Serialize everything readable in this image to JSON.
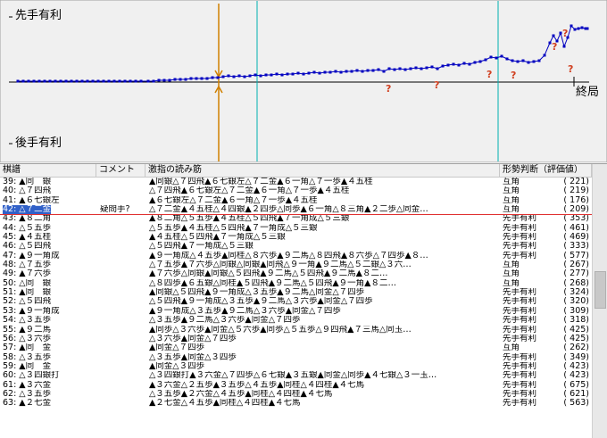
{
  "graph": {
    "label_top": "先手有利",
    "label_bottom": "後手有利",
    "label_end": "終局",
    "accent": "#0000c0",
    "cursor_color": "#d08000",
    "question_color": "#d04020"
  },
  "columns": [
    "棋譜",
    "コメント",
    "激指の読み筋",
    "形勢判断（評価値）"
  ],
  "rows": [
    {
      "move": "39: ▲同　銀",
      "comment": "",
      "pv": "▲同銀△７四飛▲６七銀左△７二金▲６一角△７一歩▲４五桂",
      "judge": "互角",
      "value": "(  221)"
    },
    {
      "move": "40: △７四飛",
      "comment": "",
      "pv": "△７四飛▲６七銀左△７二金▲６一角△７一歩▲４五桂",
      "judge": "互角",
      "value": "(  219)"
    },
    {
      "move": "41: ▲６七銀左",
      "comment": "",
      "pv": "▲６七銀左△７二金▲６一角△７一歩▲４五桂",
      "judge": "互角",
      "value": "(  176)"
    },
    {
      "move": "42: △７二金",
      "comment": "疑問手?",
      "pv": "△７二金▲４五桂△４四銀▲２四歩△同歩▲６一角△８三角▲２二歩△同金…",
      "judge": "互角",
      "value": "(  209)",
      "selected": true
    },
    {
      "move": "43: ▲８二角",
      "comment": "",
      "pv": "▲８二角△５五歩▲４五桂△５四飛▲７一角成△５三銀",
      "judge": "先手有利",
      "value": "(  353)"
    },
    {
      "move": "44: △５五歩",
      "comment": "",
      "pv": "△５五歩▲４五桂△５四飛▲７一角成△５三銀",
      "judge": "先手有利",
      "value": "(  461)"
    },
    {
      "move": "45: ▲４五桂",
      "comment": "",
      "pv": "▲４五桂△５四飛▲７一角成△５三銀",
      "judge": "先手有利",
      "value": "(  469)"
    },
    {
      "move": "46: △５四飛",
      "comment": "",
      "pv": "△５四飛▲７一角成△５三銀",
      "judge": "先手有利",
      "value": "(  333)"
    },
    {
      "move": "47: ▲９一角成",
      "comment": "",
      "pv": "▲９一角成△４五歩▲同桂△８六歩▲９二馬△８四飛▲８六歩△７四歩▲８…",
      "judge": "先手有利",
      "value": "(  577)"
    },
    {
      "move": "48: △７五歩",
      "comment": "",
      "pv": "△７五歩▲７六歩△同銀△同銀▲同飛△９一角▲９二馬△５二銀△３六…",
      "judge": "互角",
      "value": "(  267)"
    },
    {
      "move": "49: ▲７六歩",
      "comment": "",
      "pv": "▲７六歩△同銀▲同銀△５四飛▲９二馬△５四飛▲９二馬▲８二…",
      "judge": "互角",
      "value": "(  277)"
    },
    {
      "move": "50: △同　銀",
      "comment": "",
      "pv": "△８四歩▲６五銀△同桂▲５四飛▲９二馬△５四飛▲９一角▲８二…",
      "judge": "互角",
      "value": "(  268)"
    },
    {
      "move": "51: ▲同　銀",
      "comment": "",
      "pv": "▲同銀△５四飛▲９一角成△３五歩▲９二馬△同金△７四歩",
      "judge": "先手有利",
      "value": "(  324)"
    },
    {
      "move": "52: △５四飛",
      "comment": "",
      "pv": "△５四飛▲９一角成△３五歩▲９二馬△３六歩▲同金△７四歩",
      "judge": "先手有利",
      "value": "(  320)"
    },
    {
      "move": "53: ▲９一角成",
      "comment": "",
      "pv": "▲９一角成△３五歩▲９二馬△３六歩▲同金△７四歩",
      "judge": "先手有利",
      "value": "(  309)"
    },
    {
      "move": "54: △３五歩",
      "comment": "",
      "pv": "△３五歩▲９二馬△３六歩▲同金△７四歩",
      "judge": "先手有利",
      "value": "(  318)"
    },
    {
      "move": "55: ▲９二馬",
      "comment": "",
      "pv": "▲同歩△３六歩▲同金△５六歩▲同歩△５五歩△９四飛▲７三馬△同玉…",
      "judge": "先手有利",
      "value": "(  425)"
    },
    {
      "move": "56: △３六歩",
      "comment": "",
      "pv": "△３六歩▲同金△７四歩",
      "judge": "先手有利",
      "value": "(  425)"
    },
    {
      "move": "57: ▲同　金",
      "comment": "",
      "pv": "▲同金△７四歩",
      "judge": "互角",
      "value": "(  262)"
    },
    {
      "move": "58: △３五歩",
      "comment": "",
      "pv": "△３五歩▲同金△３四歩",
      "judge": "先手有利",
      "value": "(  349)"
    },
    {
      "move": "59: ▲同　金",
      "comment": "",
      "pv": "▲同金△３四歩",
      "judge": "先手有利",
      "value": "(  423)"
    },
    {
      "move": "60: △３四銀打",
      "comment": "",
      "pv": "△３四銀打▲３六金△７四歩△６七銀▲３五銀▲同金△同歩▲４七銀△３一玉…",
      "judge": "先手有利",
      "value": "(  423)"
    },
    {
      "move": "61: ▲３六金",
      "comment": "",
      "pv": "▲３六金△２五歩▲３五歩△４五歩▲同桂△４四桂▲４七馬",
      "judge": "先手有利",
      "value": "(  675)"
    },
    {
      "move": "62: △３五歩",
      "comment": "",
      "pv": "△３五歩▲２六金△４五歩▲同桂△４四桂▲４七馬",
      "judge": "先手有利",
      "value": "(  621)"
    },
    {
      "move": "63: ▲２七金",
      "comment": "",
      "pv": "▲２七金△４五歩▲同桂△４四桂▲４七馬",
      "judge": "先手有利",
      "value": "(  563)"
    }
  ]
}
